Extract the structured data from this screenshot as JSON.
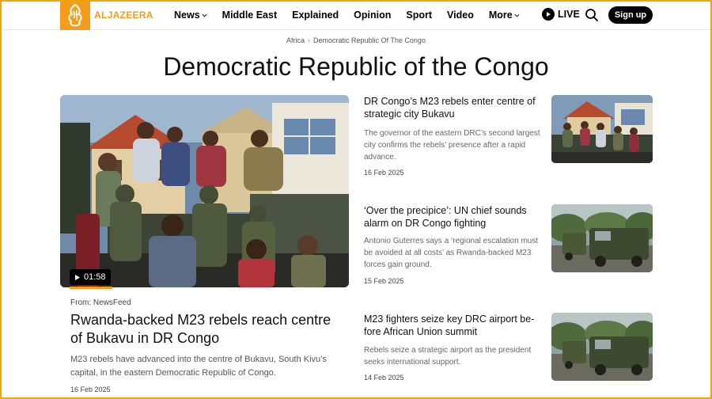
{
  "header": {
    "logo_text": "ALJAZEERA",
    "nav": [
      {
        "label": "News",
        "has_dropdown": true
      },
      {
        "label": "Middle East",
        "has_dropdown": false
      },
      {
        "label": "Explained",
        "has_dropdown": false
      },
      {
        "label": "Opinion",
        "has_dropdown": false
      },
      {
        "label": "Sport",
        "has_dropdown": false
      },
      {
        "label": "Video",
        "has_dropdown": false
      },
      {
        "label": "More",
        "has_dropdown": true
      }
    ],
    "live_label": "LIVE",
    "signup_label": "Sign up"
  },
  "breadcrumb": {
    "items": [
      "Africa",
      "Democratic Republic Of The Congo"
    ]
  },
  "page_title": "Democratic Republic of the Congo",
  "featured": {
    "duration": "01:58",
    "from": "From: NewsFeed",
    "headline": "Rwanda-backed M23 rebels reach centre of Bukavu in DR Congo",
    "summary": "M23 rebels have advanced into the centre of Bukavu, South Kivu’s capital, in the eastern Democratic Republic of Congo.",
    "date": "16 Feb 2025"
  },
  "stories": [
    {
      "headline": "DR Congo’s M23 rebels enter centre of strategic city Bukavu",
      "summary": "The governor of the eastern DRC’s second largest city confirms the rebels’ presence after a rapid advance.",
      "date": "16 Feb 2025"
    },
    {
      "headline": "‘Over the precipice’: UN chief sounds alarm on DR Congo fighting",
      "summary": "Antonio Guterres says a ‘regional escalation must be avoided at all costs’ as Rwanda-backed M23 forces gain ground.",
      "date": "15 Feb 2025"
    },
    {
      "headline": "M23 fighters seize key DRC airport be-fore African Union summit",
      "summary": "Rebels seize a strategic airport as the president seeks international support.",
      "date": "14 Feb 2025"
    }
  ],
  "colors": {
    "brand": "#f59c1a",
    "frame": "#f0a60b",
    "text": "#111111",
    "muted": "#666666"
  }
}
